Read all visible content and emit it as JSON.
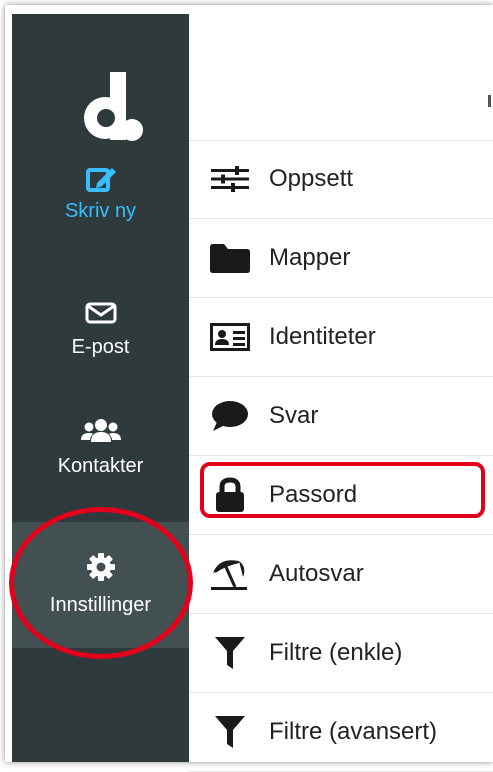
{
  "sidebar": {
    "items": [
      {
        "label": "Skriv ny",
        "icon": "edit-icon",
        "color": "#37beff"
      },
      {
        "label": "E-post",
        "icon": "mail-icon"
      },
      {
        "label": "Kontakter",
        "icon": "users-icon"
      },
      {
        "label": "Innstillinger",
        "icon": "gear-icon",
        "selected": true
      }
    ]
  },
  "settings": {
    "items": [
      {
        "label": "Oppsett",
        "icon": "sliders-icon"
      },
      {
        "label": "Mapper",
        "icon": "folder-icon"
      },
      {
        "label": "Identiteter",
        "icon": "id-card-icon"
      },
      {
        "label": "Svar",
        "icon": "speech-bubble-icon"
      },
      {
        "label": "Passord",
        "icon": "lock-icon"
      },
      {
        "label": "Autosvar",
        "icon": "beach-umbrella-icon"
      },
      {
        "label": "Filtre (enkle)",
        "icon": "filter-icon"
      },
      {
        "label": "Filtre (avansert)",
        "icon": "filter-icon"
      }
    ]
  },
  "colors": {
    "sidebar_bg": "#2f3a3c",
    "selected_bg": "#435052",
    "accent": "#37beff",
    "highlight": "#e3001b"
  }
}
